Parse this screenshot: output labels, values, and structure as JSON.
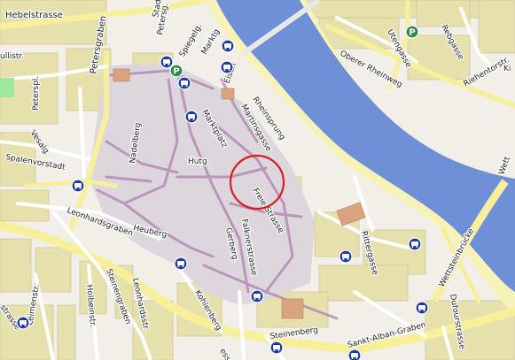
{
  "map": {
    "colors": {
      "background": "#f2efe9",
      "water": "#6f8fd6",
      "riverbank": "#f7f3b8",
      "major_road": "#f7ef9a",
      "pedestrian": "#e3d3e3",
      "pedestrian_edge": "#b58db5",
      "building": "#e6e0ad",
      "building_edge": "#cfc79a",
      "park": "#9ee79e",
      "transit_icon": "#1f3aa6",
      "parking_icon": "#2c8a4a",
      "highlight_circle": "#d61e1e"
    },
    "street_labels": [
      {
        "id": "hebelstrasse",
        "text": "Hebelstrasse"
      },
      {
        "id": "petersgraben",
        "text": "Petersgraben"
      },
      {
        "id": "petersgasse",
        "text": "Petersg."
      },
      {
        "id": "spiegelgasse",
        "text": "Spiegelg."
      },
      {
        "id": "marktgasse",
        "text": "Marktg"
      },
      {
        "id": "eisengasse",
        "text": "Eisen"
      },
      {
        "id": "rheinsprung",
        "text": "Rheinsprung"
      },
      {
        "id": "martinsgasse",
        "text": "Martinsgasse"
      },
      {
        "id": "marktplatz",
        "text": "Marktplatz"
      },
      {
        "id": "nadelberg",
        "text": "Nadelberg"
      },
      {
        "id": "hutg",
        "text": "Hutg."
      },
      {
        "id": "freie-strasse",
        "text": "Freie Strasse"
      },
      {
        "id": "petersplatz",
        "text": "Peterspl."
      },
      {
        "id": "vesalg",
        "text": "Vesalg."
      },
      {
        "id": "spalenvorstadt",
        "text": "Spalenvorstadt"
      },
      {
        "id": "leonhardsgraben",
        "text": "Leonhardsgraben"
      },
      {
        "id": "heuberg",
        "text": "Heuberg"
      },
      {
        "id": "gerberg",
        "text": "Gerberg."
      },
      {
        "id": "falknerstrasse",
        "text": "Falknerstrasse"
      },
      {
        "id": "rittergasse",
        "text": "Rittergasse"
      },
      {
        "id": "wettsteinbruecke",
        "text": "Wettsteinbrücke"
      },
      {
        "id": "uferstrasse",
        "text": "Utengasse"
      },
      {
        "id": "rebgasse",
        "text": "Rebgasse"
      },
      {
        "id": "oberer-rheinweg",
        "text": "Oberer Rheinweg"
      },
      {
        "id": "riehentorstr",
        "text": "Riehentorstr."
      },
      {
        "id": "steinengraben",
        "text": "Steinengraben"
      },
      {
        "id": "leonhardsstr",
        "text": "Leonhardsstr."
      },
      {
        "id": "kohlenberg",
        "text": "Kohlenberg"
      },
      {
        "id": "steinenberg",
        "text": "Steinenberg"
      },
      {
        "id": "st-alban-graben",
        "text": "Sankt-Alban-Graben"
      },
      {
        "id": "dufourstrasse",
        "text": "Dufourstrasse"
      },
      {
        "id": "leimenstr",
        "text": "Leimenstr."
      },
      {
        "id": "holbeinstr",
        "text": "Holbeinstr."
      },
      {
        "id": "missionsstr",
        "text": "ullistr."
      },
      {
        "id": "kirchgasse",
        "text": "Ki"
      },
      {
        "id": "wettsteinplatz",
        "text": "Wett"
      },
      {
        "id": "stadthausg",
        "text": "Stad"
      },
      {
        "id": "klostrasse",
        "text": "strasse"
      },
      {
        "id": "elisabethen",
        "text": "ess"
      }
    ],
    "icons": {
      "transit": "bus-stop-icon",
      "parking": "parking-icon"
    }
  }
}
